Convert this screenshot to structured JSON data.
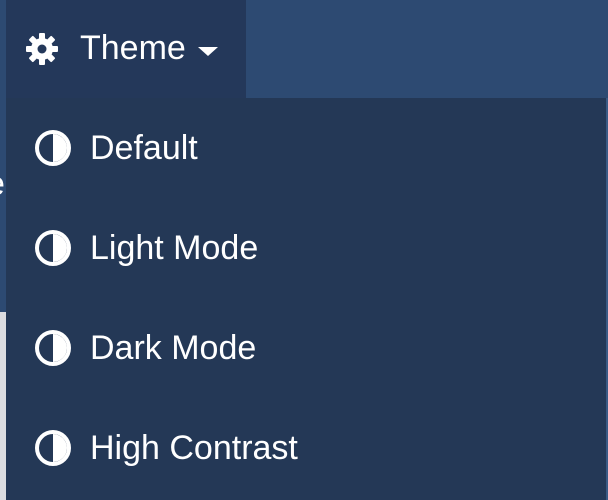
{
  "header": {
    "clipped_text": "e"
  },
  "theme_toggle": {
    "label": "Theme",
    "icon": "gear-icon",
    "caret_icon": "caret-down-icon"
  },
  "menu": {
    "items": [
      {
        "label": "Default",
        "icon": "contrast-icon"
      },
      {
        "label": "Light Mode",
        "icon": "contrast-icon"
      },
      {
        "label": "Dark Mode",
        "icon": "contrast-icon"
      },
      {
        "label": "High Contrast",
        "icon": "contrast-icon"
      }
    ]
  },
  "colors": {
    "header_background": "#2d4a72",
    "toggle_background": "#24385a",
    "menu_background": "#243856",
    "text": "#ffffff",
    "page_background": "#dcdde1"
  }
}
